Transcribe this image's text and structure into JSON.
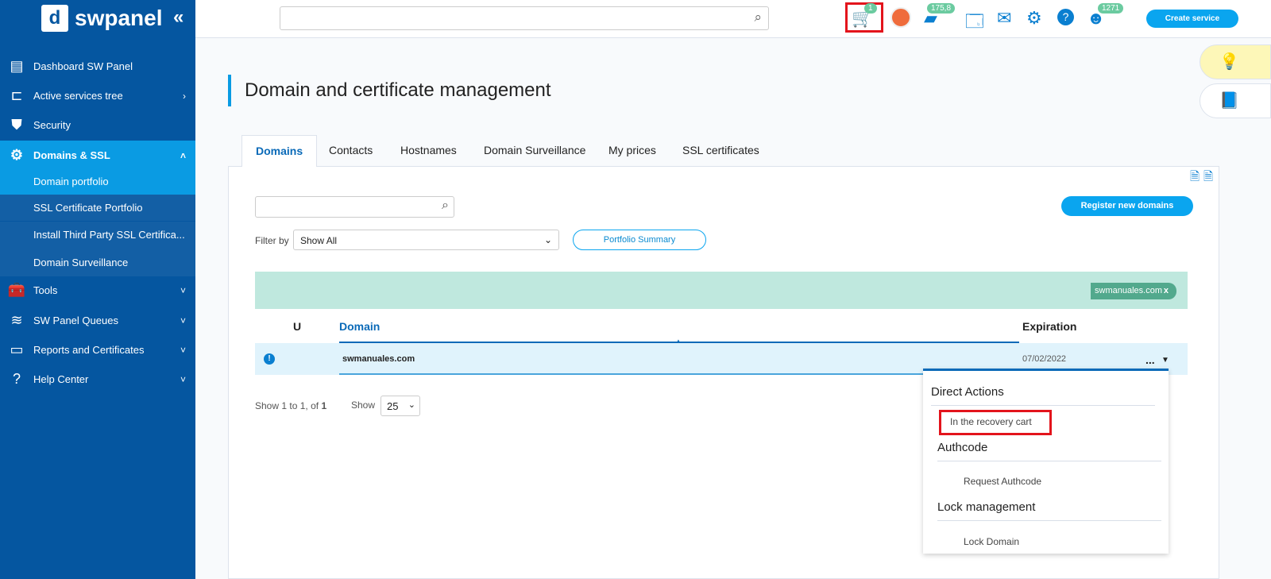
{
  "sidebar": {
    "logo": "swpanel",
    "collapse": "«",
    "items": [
      {
        "label": "Dashboard SW Panel",
        "icon": "dashboard-icon"
      },
      {
        "label": "Active services tree",
        "icon": "tree-icon"
      },
      {
        "label": "Security",
        "icon": "shield-icon"
      },
      {
        "label": "Domains & SSL",
        "icon": "gear-www-icon"
      },
      {
        "label": "Tools",
        "icon": "toolbox-icon"
      },
      {
        "label": "SW Panel Queues",
        "icon": "layers-icon"
      },
      {
        "label": "Reports and Certificates",
        "icon": "certificate-icon"
      },
      {
        "label": "Help Center",
        "icon": "help-icon"
      }
    ],
    "subitems": [
      "Domain portfolio",
      "SSL Certificate Portfolio",
      "Install Third Party SSL Certifica...",
      "Domain Surveillance"
    ]
  },
  "topbar": {
    "search_placeholder": "",
    "cart_badge": "1",
    "wallet_badge": "175,8",
    "support_badge": "1271",
    "create_service": "Create service"
  },
  "page": {
    "title": "Domain and certificate management",
    "tabs": [
      "Domains",
      "Contacts",
      "Hostnames",
      "Domain Surveillance",
      "My prices",
      "SSL certificates"
    ],
    "register_button": "Register new domains",
    "filter_label": "Filter by",
    "filter_value": "Show All",
    "summary_button": "Portfolio Summary",
    "chip": "swmanuales.com",
    "chip_close": "x",
    "columns": {
      "u": "U",
      "domain": "Domain",
      "expiration": "Expiration"
    },
    "rows": [
      {
        "domain": "swmanuales.com",
        "expiration": "07/02/2022",
        "actions": "..."
      }
    ],
    "pagination": {
      "show_prefix": "Show ",
      "from": "1",
      " to_text": " to ",
      "to": "1",
      "of_text": ", of ",
      "total": "1",
      "show_label": "Show",
      "page_size": "25"
    }
  },
  "menu": {
    "direct_actions": "Direct Actions",
    "recovery_cart": "In the recovery cart",
    "authcode": "Authcode",
    "request_authcode": "Request Authcode",
    "lock_management": "Lock management",
    "lock_domain": "Lock Domain"
  },
  "colors": {
    "sidebar": "#0556a0",
    "accent": "#0a9be3",
    "highlight": "#e3141c"
  }
}
